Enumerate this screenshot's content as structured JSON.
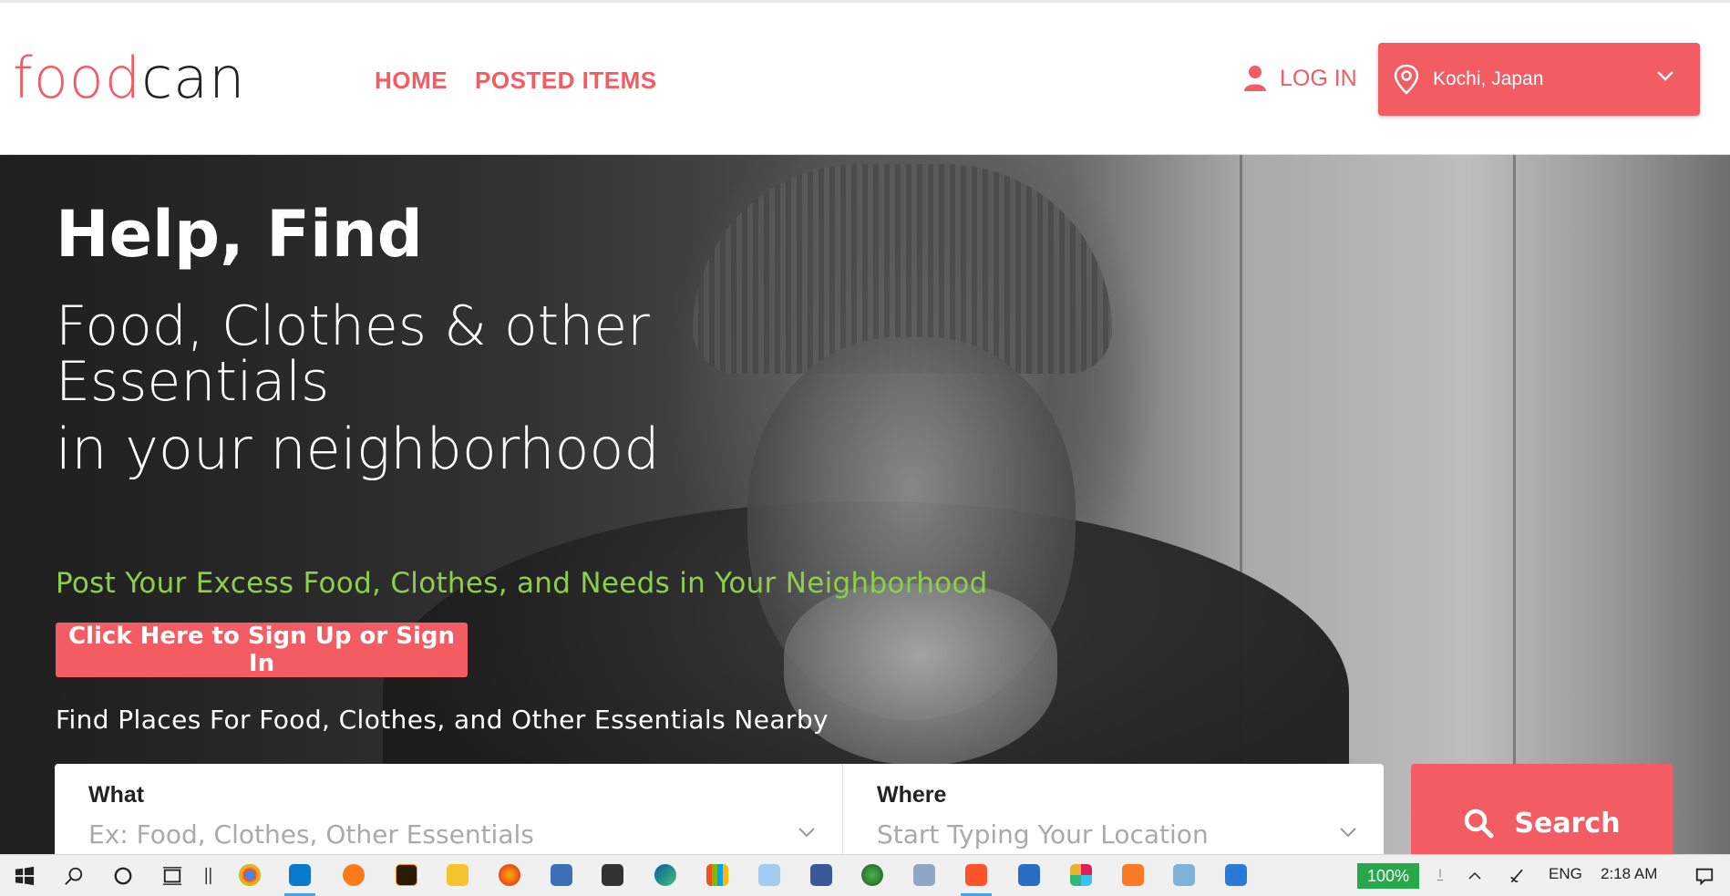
{
  "header": {
    "logo_part1": "food",
    "logo_part2": "can",
    "nav": [
      {
        "label": "HOME"
      },
      {
        "label": "POSTED ITEMS"
      }
    ],
    "login_label": "LOG IN",
    "location_value": "Kochi, Japan"
  },
  "hero": {
    "title": "Help, Find",
    "subtitle_line1": "Food, Clothes & other Essentials",
    "subtitle_line2": "in your neighborhood",
    "tagline": "Post Your Excess Food, Clothes, and Needs in Your Neighborhood",
    "cta_label": "Click Here to Sign Up or Sign In",
    "find_text": "Find Places For Food, Clothes, and Other Essentials Nearby"
  },
  "search": {
    "what_label": "What",
    "what_placeholder": "Ex: Food, Clothes, Other Essentials",
    "where_label": "Where",
    "where_placeholder": "Start Typing Your Location",
    "button_label": "Search"
  },
  "taskbar": {
    "battery": "100%",
    "language": "ENG",
    "time": "2:18 AM"
  },
  "colors": {
    "accent": "#f25c62",
    "tagline": "#8ad04a"
  }
}
